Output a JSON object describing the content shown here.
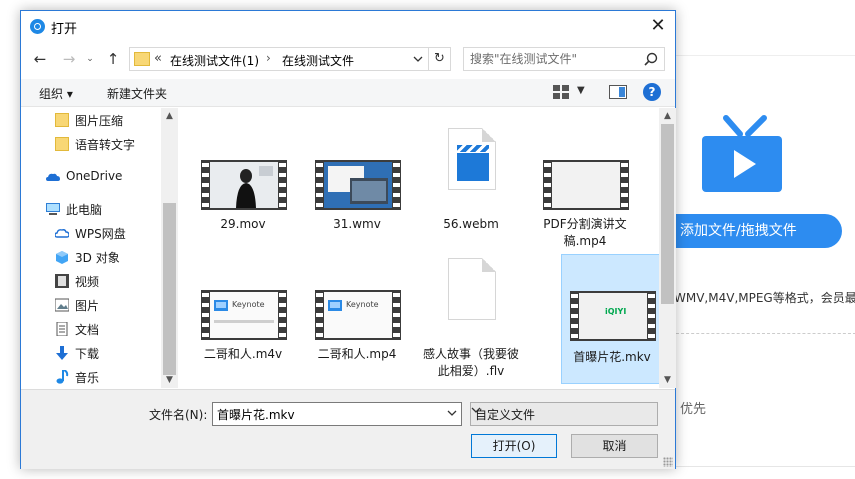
{
  "background": {
    "add_button_label": "添加文件/拖拽文件",
    "formats_text": "WMV,M4V,MPEG等格式，会员最",
    "priority_text": "优先",
    "accent_color": "#2d8cf0"
  },
  "dialog": {
    "title": "打开",
    "close_glyph": "✕",
    "nav": {
      "back": "←",
      "forward": "→",
      "recent": "⌄",
      "up": "↑",
      "refresh": "↻"
    },
    "address": {
      "overflow": "«",
      "segments": [
        "在线测试文件(1)",
        "在线测试文件"
      ],
      "separator": "›"
    },
    "search": {
      "placeholder": "搜索\"在线测试文件\""
    },
    "toolbar": {
      "organize": "组织 ▾",
      "new_folder": "新建文件夹",
      "help": "?"
    },
    "sidebar": [
      {
        "label": "图片压缩",
        "icon": "folder-icon"
      },
      {
        "label": "语音转文字",
        "icon": "folder-icon"
      },
      {
        "label": "OneDrive",
        "icon": "cloud-icon"
      },
      {
        "label": "此电脑",
        "icon": "computer-icon"
      },
      {
        "label": "WPS网盘",
        "icon": "cloud-outline-icon"
      },
      {
        "label": "3D 对象",
        "icon": "cube-icon"
      },
      {
        "label": "视频",
        "icon": "video-icon"
      },
      {
        "label": "图片",
        "icon": "picture-icon"
      },
      {
        "label": "文档",
        "icon": "document-icon"
      },
      {
        "label": "下载",
        "icon": "download-icon"
      },
      {
        "label": "音乐",
        "icon": "music-icon"
      }
    ],
    "files": [
      {
        "name": "29.mov",
        "thumb": "film-person",
        "selected": false
      },
      {
        "name": "31.wmv",
        "thumb": "film-desktop",
        "selected": false
      },
      {
        "name": "56.webm",
        "thumb": "clapper",
        "selected": false
      },
      {
        "name": "PDF分割演讲文稿.mp4",
        "thumb": "film-blank",
        "selected": false
      },
      {
        "name": "二哥和人.m4v",
        "thumb": "film-keynote",
        "selected": false
      },
      {
        "name": "二哥和人.mp4",
        "thumb": "film-keynote",
        "selected": false
      },
      {
        "name": "感人故事（我要彼此相爱）.flv",
        "thumb": "blank-doc",
        "selected": false
      },
      {
        "name": "首曝片花.mkv",
        "thumb": "film-iqiyi",
        "selected": true
      }
    ],
    "keynote_text": "Keynote",
    "iqiyi_text": "iQIYI",
    "filename_label": "文件名(N):",
    "filename_value": "首曝片花.mkv",
    "filetype_value": "自定义文件",
    "open_label": "打开(O)",
    "cancel_label": "取消"
  }
}
